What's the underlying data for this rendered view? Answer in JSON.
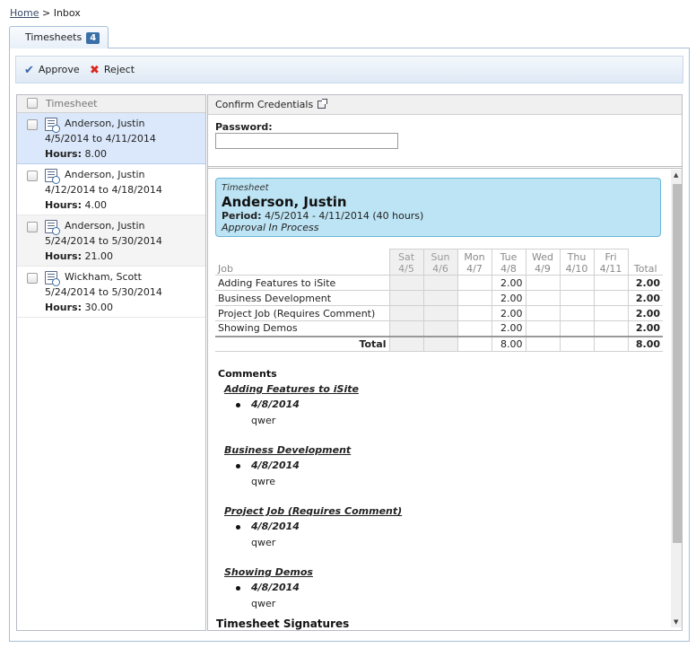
{
  "breadcrumb": {
    "home": "Home",
    "separator": ">",
    "current": "Inbox"
  },
  "tab": {
    "label": "Timesheets",
    "count": "4"
  },
  "toolbar": {
    "approve": "Approve",
    "reject": "Reject"
  },
  "list": {
    "header": "Timesheet",
    "items": [
      {
        "name": "Anderson, Justin",
        "dates": "4/5/2014 to 4/11/2014",
        "hours_label": "Hours:",
        "hours": "8.00"
      },
      {
        "name": "Anderson, Justin",
        "dates": "4/12/2014 to 4/18/2014",
        "hours_label": "Hours:",
        "hours": "4.00"
      },
      {
        "name": "Anderson, Justin",
        "dates": "5/24/2014 to 5/30/2014",
        "hours_label": "Hours:",
        "hours": "21.00"
      },
      {
        "name": "Wickham, Scott",
        "dates": "5/24/2014 to 5/30/2014",
        "hours_label": "Hours:",
        "hours": "30.00"
      }
    ]
  },
  "credentials": {
    "header": "Confirm Credentials",
    "password_label": "Password:",
    "password_value": ""
  },
  "detail": {
    "tag": "Timesheet",
    "name": "Anderson, Justin",
    "period_label": "Period:",
    "period": "4/5/2014 - 4/11/2014 (40 hours)",
    "status": "Approval In Process"
  },
  "grid": {
    "job_header": "Job",
    "total_header": "Total",
    "days": [
      {
        "dow": "Sat",
        "date": "4/5"
      },
      {
        "dow": "Sun",
        "date": "4/6"
      },
      {
        "dow": "Mon",
        "date": "4/7"
      },
      {
        "dow": "Tue",
        "date": "4/8"
      },
      {
        "dow": "Wed",
        "date": "4/9"
      },
      {
        "dow": "Thu",
        "date": "4/10"
      },
      {
        "dow": "Fri",
        "date": "4/11"
      }
    ],
    "rows": [
      {
        "job": "Adding Features to iSite",
        "tue": "2.00",
        "total": "2.00"
      },
      {
        "job": "Business Development",
        "tue": "2.00",
        "total": "2.00"
      },
      {
        "job": "Project Job (Requires Comment)",
        "tue": "2.00",
        "total": "2.00"
      },
      {
        "job": "Showing Demos",
        "tue": "2.00",
        "total": "2.00"
      }
    ],
    "totals": {
      "label": "Total",
      "tue": "8.00",
      "total": "8.00"
    }
  },
  "comments": {
    "heading": "Comments",
    "items": [
      {
        "job": "Adding Features to iSite",
        "date": "4/8/2014",
        "text": "qwer"
      },
      {
        "job": "Business Development",
        "date": "4/8/2014",
        "text": "qwre"
      },
      {
        "job": "Project Job (Requires Comment)",
        "date": "4/8/2014",
        "text": "qwer"
      },
      {
        "job": "Showing Demos",
        "date": "4/8/2014",
        "text": "qwer"
      }
    ],
    "next_section": "Timesheet Signatures"
  }
}
